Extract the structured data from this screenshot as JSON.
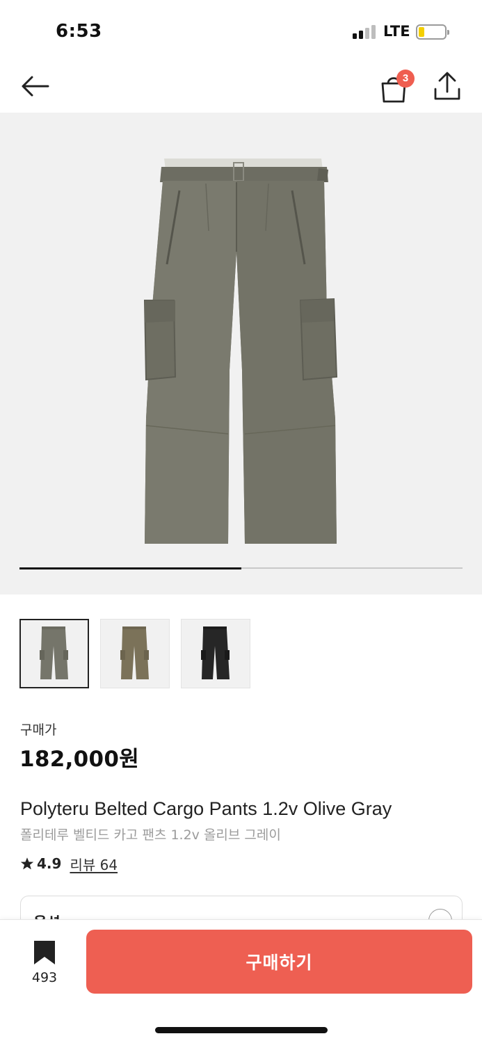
{
  "status": {
    "time": "6:53",
    "network": "LTE",
    "battery_color": "#f4cf00"
  },
  "nav": {
    "back_icon": "arrow-left-icon",
    "cart_icon": "shopping-bag-icon",
    "cart_badge": "3",
    "share_icon": "share-upload-icon"
  },
  "gallery": {
    "image_count": 2,
    "current_index": 1,
    "progress_fraction": 0.5,
    "thumbnails": [
      {
        "color": "olive-gray",
        "selected": true
      },
      {
        "color": "brown",
        "selected": false
      },
      {
        "color": "black",
        "selected": false
      }
    ]
  },
  "product": {
    "price_label": "구매가",
    "price": "182,000원",
    "name_en": "Polyteru Belted Cargo Pants 1.2v Olive Gray",
    "name_ko": "폴리테루 벨티드 카고 팬츠 1.2v 올리브 그레이",
    "rating": "4.9",
    "review_label": "리뷰 64"
  },
  "option": {
    "label": "옵션"
  },
  "bottom": {
    "bookmark_count": "493",
    "buy_label": "구매하기"
  },
  "colors": {
    "accent": "#ee5f52",
    "badge": "#ef5e50"
  }
}
